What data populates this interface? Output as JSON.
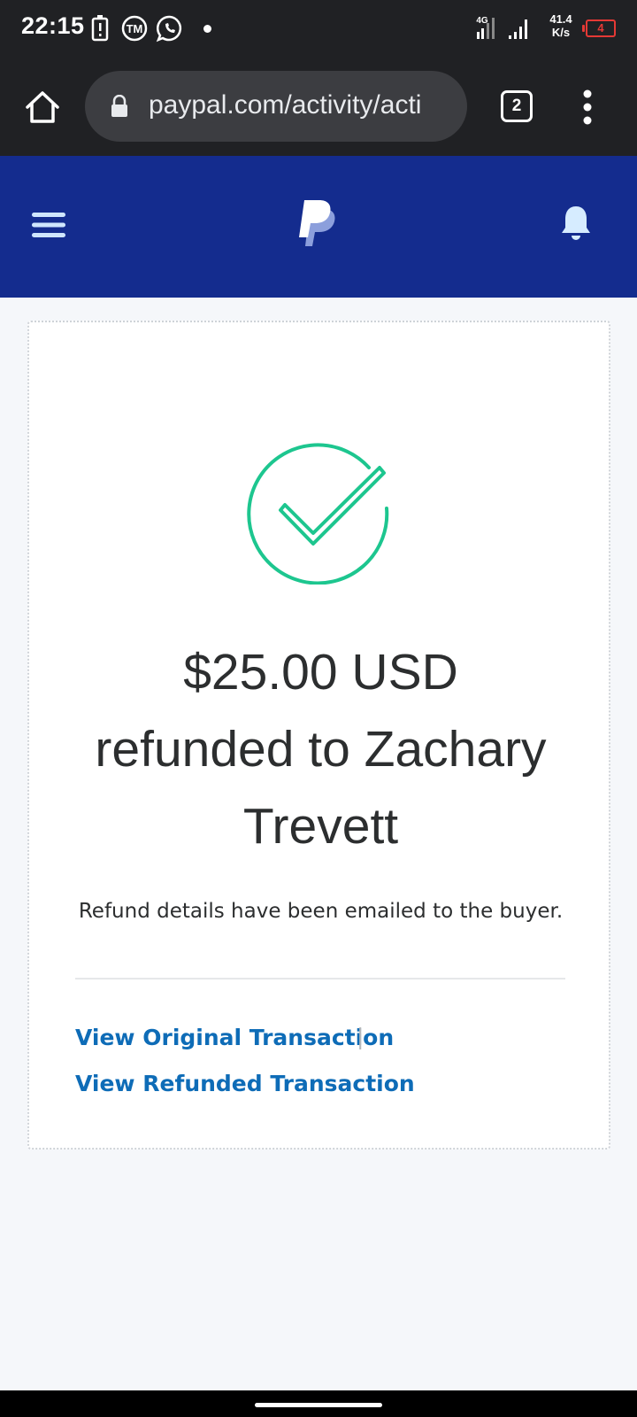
{
  "status_bar": {
    "time": "22:15",
    "network_speed": "41.4 K/s",
    "network_type": "4G",
    "battery_level": "4"
  },
  "browser": {
    "url": "paypal.com/activity/acti",
    "tab_count": "2"
  },
  "header": {
    "brand_color": "#142c8e"
  },
  "card": {
    "amount_line": "$25.00 USD",
    "refund_line": "refunded to Zachary",
    "name_line": "Trevett",
    "details_text": "Refund details have been emailed to the buyer.",
    "separator": "|",
    "link_original": "View Original Transaction",
    "link_refunded": "View Refunded Transaction",
    "success_color": "#1dc68f",
    "link_color": "#0e6cb7"
  }
}
